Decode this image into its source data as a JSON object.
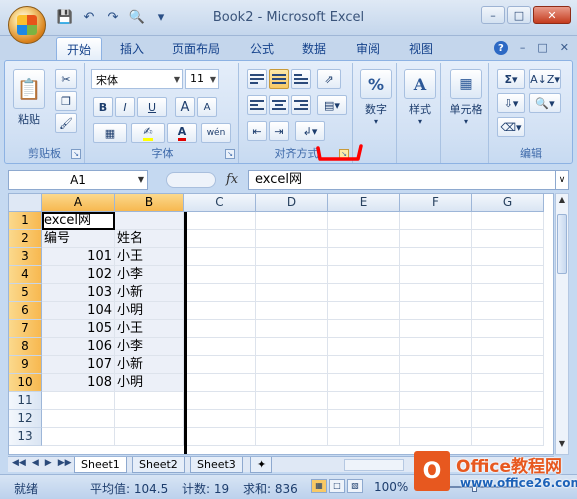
{
  "window": {
    "title": "Book2 - Microsoft Excel"
  },
  "tabs": [
    "开始",
    "插入",
    "页面布局",
    "公式",
    "数据",
    "审阅",
    "视图"
  ],
  "ribbon": {
    "clipboard": {
      "label": "剪贴板",
      "paste": "粘贴"
    },
    "font": {
      "label": "字体",
      "name": "宋体",
      "size": "11",
      "bold": "B",
      "italic": "I",
      "underline": "U",
      "grow": "A",
      "shrink": "A",
      "color_letter": "A",
      "wen": "wén"
    },
    "alignment": {
      "label": "对齐方式"
    },
    "number": {
      "label": "数字",
      "icon": "%"
    },
    "styles": {
      "label": "样式"
    },
    "cells": {
      "label": "单元格"
    },
    "editing": {
      "label": "编辑"
    }
  },
  "formula_bar": {
    "name_box": "A1",
    "fx": "fx",
    "content": "excel网"
  },
  "columns": [
    "A",
    "B",
    "C",
    "D",
    "E",
    "F",
    "G"
  ],
  "rows": [
    {
      "n": "1",
      "a": "excel网",
      "b": ""
    },
    {
      "n": "2",
      "a": "编号",
      "b": "姓名"
    },
    {
      "n": "3",
      "a": "101",
      "b": "小王"
    },
    {
      "n": "4",
      "a": "102",
      "b": "小李"
    },
    {
      "n": "5",
      "a": "103",
      "b": "小新"
    },
    {
      "n": "6",
      "a": "104",
      "b": "小明"
    },
    {
      "n": "7",
      "a": "105",
      "b": "小王"
    },
    {
      "n": "8",
      "a": "106",
      "b": "小李"
    },
    {
      "n": "9",
      "a": "107",
      "b": "小新"
    },
    {
      "n": "10",
      "a": "108",
      "b": "小明"
    },
    {
      "n": "11",
      "a": "",
      "b": ""
    },
    {
      "n": "12",
      "a": "",
      "b": ""
    },
    {
      "n": "13",
      "a": "",
      "b": ""
    }
  ],
  "sheets": [
    "Sheet1",
    "Sheet2",
    "Sheet3"
  ],
  "status": {
    "ready": "就绪",
    "average": "平均值: 104.5",
    "count": "计数: 19",
    "sum": "求和: 836",
    "zoom": "100%"
  },
  "watermark": {
    "title": "Office教程网",
    "url": "www.office26.com",
    "logo": "O"
  }
}
